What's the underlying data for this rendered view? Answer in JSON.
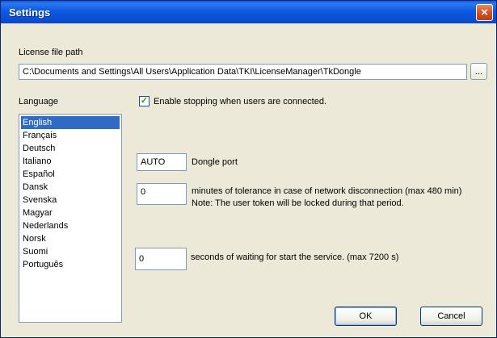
{
  "window": {
    "title": "Settings",
    "close_label": "×"
  },
  "license": {
    "label": "License file path",
    "path_value": "C:\\Documents and Settings\\All Users\\Application Data\\TKI\\LicenseManager\\TkDongle",
    "browse_label": "..."
  },
  "language": {
    "label": "Language",
    "selected": "English",
    "items": [
      "English",
      "Français",
      "Deutsch",
      "Italiano",
      "Español",
      "Dansk",
      "Svenska",
      "Magyar",
      "Nederlands",
      "Norsk",
      "Suomi",
      "Português"
    ]
  },
  "stopping": {
    "label": "Enable stopping when users are connected.",
    "checked": true
  },
  "dongle_port": {
    "value": "AUTO",
    "label": "Dongle port"
  },
  "tolerance": {
    "value": "0",
    "label": "minutes of tolerance in case of network disconnection (max 480 min)",
    "note": "Note: The user token will be locked during that period."
  },
  "waiting": {
    "value": "0",
    "label": "seconds of waiting for start the service. (max 7200 s)"
  },
  "buttons": {
    "ok": "OK",
    "cancel": "Cancel"
  }
}
